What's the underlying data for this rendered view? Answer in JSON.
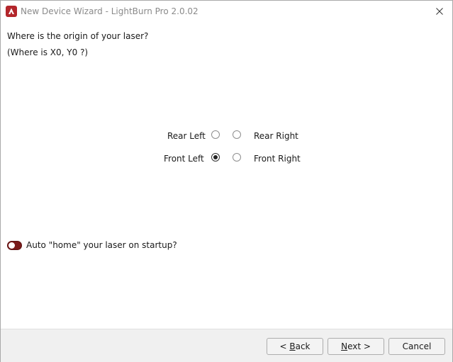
{
  "window": {
    "title": "New Device Wizard - LightBurn Pro 2.0.02",
    "app_icon": "lightburn-icon",
    "close_icon": "close-icon"
  },
  "content": {
    "question": "Where is the origin of your laser?",
    "subquestion": "(Where is X0, Y0 ?)",
    "origin_options": {
      "rear_left": {
        "label": "Rear Left",
        "checked": false
      },
      "rear_right": {
        "label": "Rear Right",
        "checked": false
      },
      "front_left": {
        "label": "Front Left",
        "checked": true
      },
      "front_right": {
        "label": "Front Right",
        "checked": false
      }
    },
    "auto_home": {
      "label": "Auto \"home\" your laser on startup?",
      "enabled": false
    }
  },
  "footer": {
    "back": {
      "prefix": "< ",
      "mnemonic": "B",
      "rest": "ack"
    },
    "next": {
      "mnemonic": "N",
      "rest": "ext >"
    },
    "cancel": "Cancel"
  }
}
